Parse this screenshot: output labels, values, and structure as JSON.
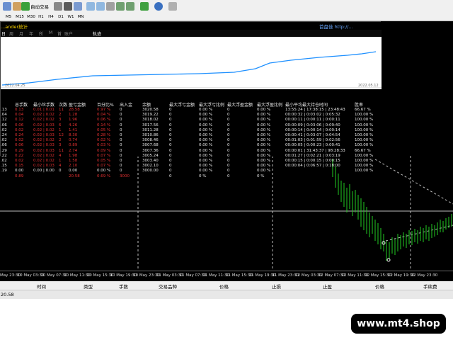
{
  "toolbar": {
    "autotrade_label": "自动交易",
    "timeframes": [
      "M5",
      "M15",
      "M30",
      "H1",
      "H4",
      "D1",
      "W1",
      "MN"
    ]
  },
  "panel": {
    "title": "...ander统计",
    "link": "首盘佳 http://...",
    "tabs": [
      "日",
      "周",
      "月",
      "年",
      "所",
      "M",
      "首",
      "账户"
    ],
    "button_label": "轨迹",
    "start_date": "2022.04.25",
    "end_date": "2022.05.12",
    "columns": [
      "总手数",
      "最小伙手数",
      "次数",
      "盈亏金额",
      "百分比%",
      "出入金",
      "余额",
      "最大浮亏金额",
      "最大浮亏比例",
      "最大浮盈金额",
      "最大浮盈比例",
      "最小平均最大持仓时间",
      "胜率"
    ],
    "rows": [
      {
        "label": ".13",
        "lots": "0.13",
        "min": "0.01 | 0.01",
        "n": "11",
        "pnl": "28.58",
        "pct": "0.97 %",
        "io": "0",
        "bal": "3020.58",
        "mfl": "0",
        "mflp": "0.00 %",
        "mfp": "0",
        "mfpp": "0.00 %",
        "hold": "13:55:24 | 17:38:15 | 23:48:43",
        "win": "66.67 %"
      },
      {
        "label": ".04",
        "lots": "0.04",
        "min": "0.02 | 0.02",
        "n": "2",
        "pnl": "1.28",
        "pct": "0.04 %",
        "io": "0",
        "bal": "3019.22",
        "mfl": "0",
        "mflp": "0.00 %",
        "mfp": "0",
        "mfpp": "0.00 %",
        "hold": "00:00:32 | 0:03:02 | 0:05:32",
        "win": "100.00 %"
      },
      {
        "label": ".12",
        "lots": "0.12",
        "min": "0.02 | 0.02",
        "n": "3",
        "pnl": "1.96",
        "pct": "0.06 %",
        "io": "0",
        "bal": "3018.02",
        "mfl": "0",
        "mflp": "0.00 %",
        "mfp": "0",
        "mfpp": "0.00 %",
        "hold": "00:00:11 | 0:00:11 | 0:00:11",
        "win": "100.00 %"
      },
      {
        "label": ".06",
        "lots": "0.06",
        "min": "0.02 | 0.03",
        "n": "6",
        "pnl": "4.26",
        "pct": "0.14 %",
        "io": "0",
        "bal": "3017.56",
        "mfl": "0",
        "mflp": "0.00 %",
        "mfp": "0",
        "mfpp": "0.00 %",
        "hold": "00:00:09 | 0:03:06 | 0:09:40",
        "win": "100.00 %"
      },
      {
        "label": ".02",
        "lots": "0.02",
        "min": "0.02 | 0.02",
        "n": "1",
        "pnl": "1.41",
        "pct": "0.05 %",
        "io": "0",
        "bal": "3011.28",
        "mfl": "0",
        "mflp": "0.00 %",
        "mfp": "0",
        "mfpp": "0.00 %",
        "hold": "00:00:14 | 0:00:14 | 0:00:14",
        "win": "100.00 %"
      },
      {
        "label": ".24",
        "lots": "0.24",
        "min": "0.02 | 0.03",
        "n": "12",
        "pnl": "8.30",
        "pct": "0.28 %",
        "io": "0",
        "bal": "3010.86",
        "mfl": "0",
        "mflp": "0.00 %",
        "mfp": "0",
        "mfpp": "0.00 %",
        "hold": "00:00:41 | 0:03:07 | 0:04:54",
        "win": "100.00 %"
      },
      {
        "label": ".02",
        "lots": "0.02",
        "min": "0.02 | 0.02",
        "n": "2",
        "pnl": "0.74",
        "pct": "0.02 %",
        "io": "0",
        "bal": "3008.46",
        "mfl": "0",
        "mflp": "0.00 %",
        "mfp": "0",
        "mfpp": "0.00 %",
        "hold": "00:01:03 | 0:01:59 | 0:02:56",
        "win": "100.00 %"
      },
      {
        "label": ".06",
        "lots": "0.06",
        "min": "0.02 | 0.03",
        "n": "3",
        "pnl": "0.89",
        "pct": "0.03 %",
        "io": "0",
        "bal": "3007.68",
        "mfl": "0",
        "mflp": "0.00 %",
        "mfp": "0",
        "mfpp": "0.00 %",
        "hold": "00:00:05 | 0:00:23 | 0:00:41",
        "win": "100.00 %"
      },
      {
        "label": ".29",
        "lots": "0.29",
        "min": "0.02 | 0.03",
        "n": "11",
        "pnl": "2.74",
        "pct": "0.09 %",
        "io": "0",
        "bal": "3007.36",
        "mfl": "0",
        "mflp": "0.00 %",
        "mfp": "0",
        "mfpp": "0.00 %",
        "hold": "00:00:01 | 31:43:37 | 98:28:33",
        "win": "66.67 %"
      },
      {
        "label": ".22",
        "lots": "0.22",
        "min": "0.02 | 0.02",
        "n": "4",
        "pnl": "1.98",
        "pct": "0.07 %",
        "io": "0",
        "bal": "3005.24",
        "mfl": "0",
        "mflp": "0.00 %",
        "mfp": "0",
        "mfpp": "0.00 %",
        "hold": "00:01:27 | 0:02:21 | 0:03:19",
        "win": "100.00 %"
      },
      {
        "label": ".02",
        "lots": "0.02",
        "min": "0.02 | 0.02",
        "n": "1",
        "pnl": "1.58",
        "pct": "0.05 %",
        "io": "0",
        "bal": "3003.40",
        "mfl": "0",
        "mflp": "0.00 %",
        "mfp": "0",
        "mfpp": "0.00 %",
        "hold": "00:00:15 | 0:00:15 | 0:00:15",
        "win": "100.00 %"
      },
      {
        "label": ".15",
        "lots": "0.15",
        "min": "0.02 | 0.03",
        "n": "4",
        "pnl": "2.10",
        "pct": "0.07 %",
        "io": "0",
        "bal": "3002.10",
        "mfl": "0",
        "mflp": "0.00 %",
        "mfp": "0",
        "mfpp": "0.00 %",
        "hold": "00:00:04 | 0:06:57 | 0:18:00",
        "win": "100.00 %"
      },
      {
        "label": ".19",
        "lots": "0.00",
        "min": "0.00 | 0.00",
        "n": "0",
        "pnl": "0.00",
        "pct": "0.00 %",
        "io": "0",
        "bal": "3000.00",
        "mfl": "0",
        "mflp": "0.00 %",
        "mfp": "0",
        "mfpp": "0.00 %",
        "hold": "",
        "win": "100.00 %"
      },
      {
        "label": "",
        "lots": "0.89",
        "min": "",
        "n": "",
        "pnl": "20.58",
        "pct": "0.69 %",
        "io": "3000",
        "bal": "",
        "mfl": "0",
        "mflp": "0 %",
        "mfp": "0",
        "mfpp": "0 %",
        "hold": "",
        "win": ""
      }
    ]
  },
  "axis_labels": [
    "May 23:30",
    "10 May 03:30",
    "10 May 07:30",
    "10 May 11:30",
    "10 May 15:30",
    "10 May 19:30",
    "10 May 23:30",
    "11 May 03:30",
    "11 May 07:30",
    "11 May 11:30",
    "11 May 15:30",
    "11 May 19:30",
    "11 May 23:30",
    "12 May 03:30",
    "12 May 07:30",
    "12 May 11:30",
    "12 May 15:30",
    "12 May 19:30",
    "12 May 23:30"
  ],
  "terminal": {
    "columns": [
      "时间",
      "类型",
      "手数",
      "交易品种",
      "价格",
      "止损",
      "止盈",
      "价格",
      "手续费"
    ],
    "balance_value": "20.58"
  },
  "watermark": "www.mt4.shop",
  "colors": {
    "equity_line": "#1e90ff",
    "loss_text": "#e03030",
    "candle": "#22cc22"
  }
}
